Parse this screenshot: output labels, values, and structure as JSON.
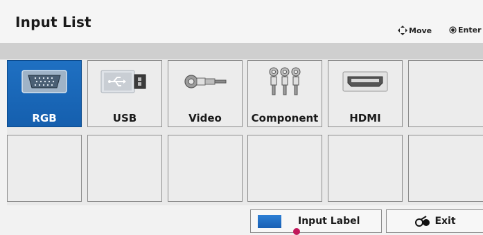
{
  "header": {
    "title": "Input List",
    "hint_move": "Move",
    "hint_enter": "Enter"
  },
  "inputs": [
    {
      "label": "RGB",
      "icon": "rgb-port-icon",
      "selected": true
    },
    {
      "label": "USB",
      "icon": "usb-port-icon",
      "selected": false
    },
    {
      "label": "Video",
      "icon": "video-rca-icon",
      "selected": false
    },
    {
      "label": "Component",
      "icon": "component-rca-icon",
      "selected": false
    },
    {
      "label": "HDMI",
      "icon": "hdmi-port-icon",
      "selected": false
    }
  ],
  "footer": {
    "input_label_button": "Input Label",
    "exit_button": "Exit"
  },
  "colors": {
    "selected_tile": "#1a68b9",
    "indicator": "#c2185b"
  }
}
